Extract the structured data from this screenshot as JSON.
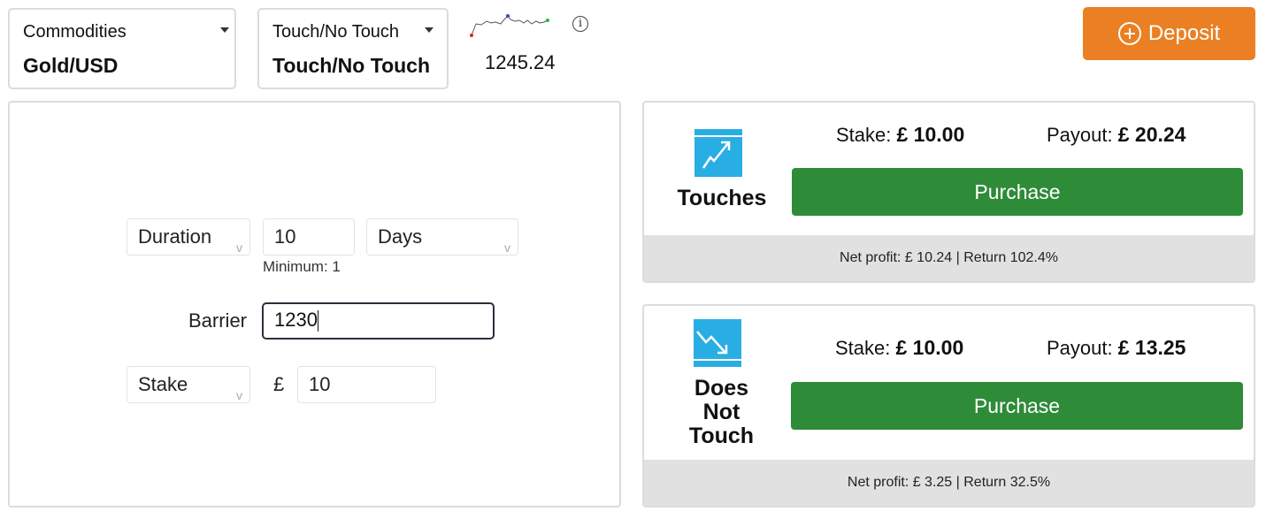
{
  "header": {
    "market_selector": {
      "category": "Commodities",
      "value": "Gold/USD"
    },
    "type_selector": {
      "category": "Touch/No Touch",
      "value": "Touch/No Touch"
    },
    "spot_price": "1245.24",
    "info_glyph": "i",
    "deposit_label": "Deposit"
  },
  "form": {
    "duration_select": "Duration",
    "duration_value": "10",
    "duration_unit": "Days",
    "duration_hint": "Minimum: 1",
    "barrier_label": "Barrier",
    "barrier_value": "1230",
    "stake_select": "Stake",
    "currency_symbol": "£",
    "stake_value": "10",
    "select_caret": "v"
  },
  "contracts": [
    {
      "title": "Touches",
      "stake_label": "Stake:",
      "stake_value": "£ 10.00",
      "payout_label": "Payout:",
      "payout_value": "£ 20.24",
      "purchase_label": "Purchase",
      "footer": "Net profit: £ 10.24 | Return 102.4%",
      "icon": "touch-icon"
    },
    {
      "title": "Does Not Touch",
      "stake_label": "Stake:",
      "stake_value": "£ 10.00",
      "payout_label": "Payout:",
      "payout_value": "£ 13.25",
      "purchase_label": "Purchase",
      "footer": "Net profit: £ 3.25 | Return 32.5%",
      "icon": "no-touch-icon"
    }
  ],
  "colors": {
    "deposit": "#ea8023",
    "purchase": "#2e8b38",
    "contract_icon": "#29aee4",
    "footer_bg": "#e1e1e1"
  }
}
